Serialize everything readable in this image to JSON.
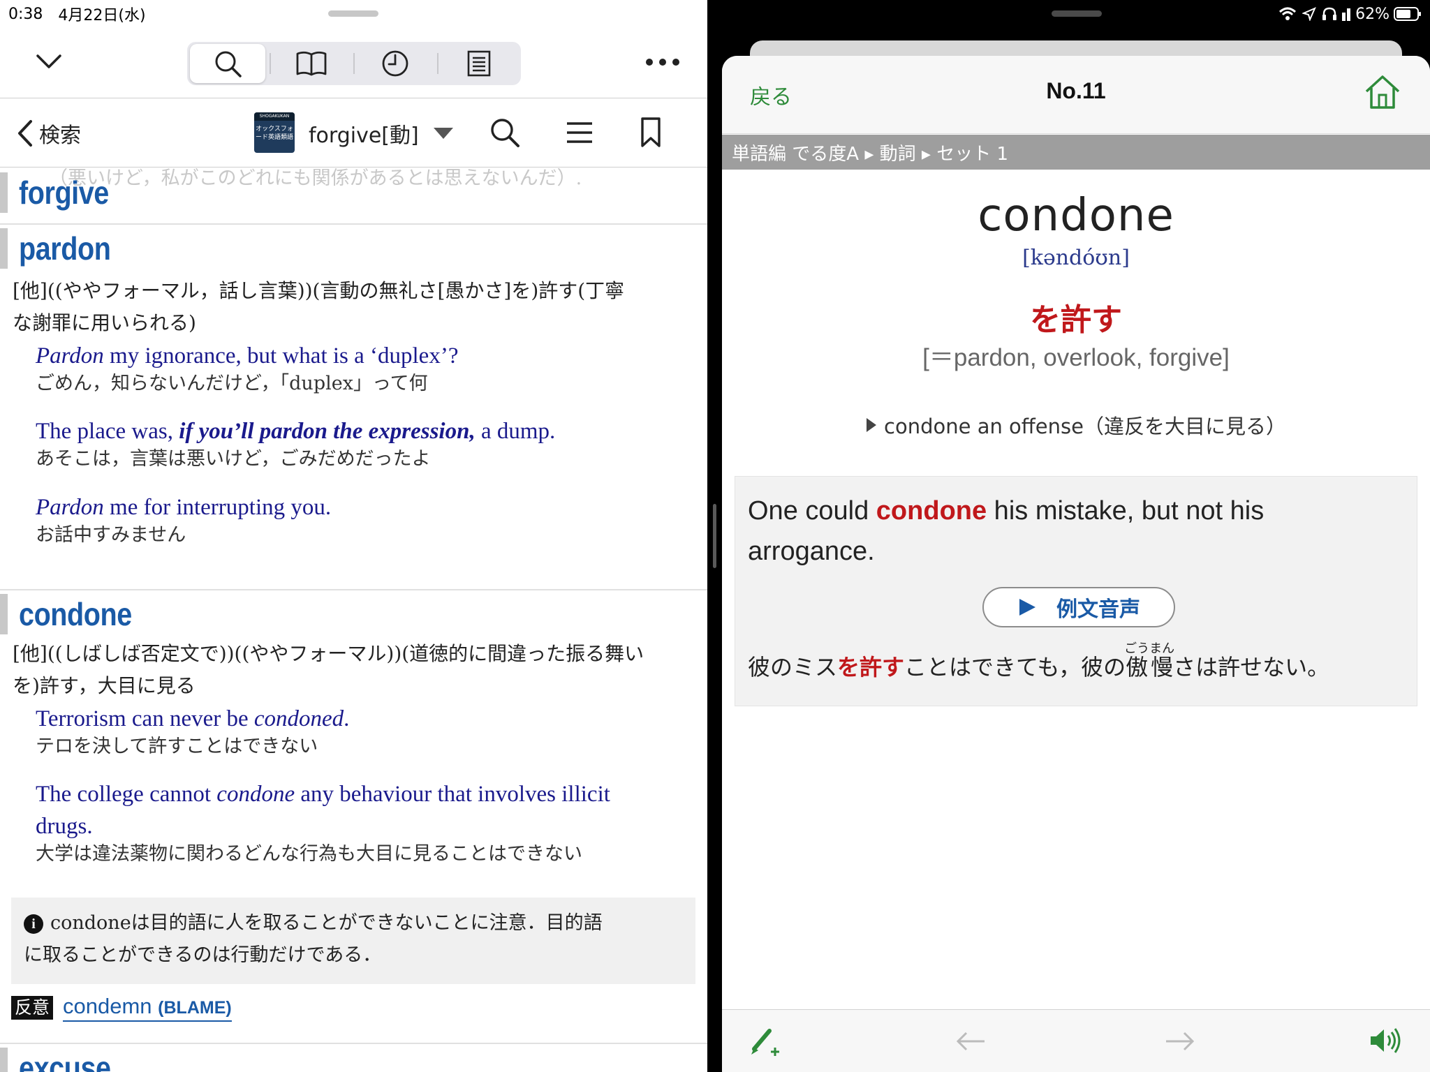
{
  "status_left": {
    "time": "0:38",
    "date": "4月22日(水)"
  },
  "status_right": {
    "battery": "62%"
  },
  "left_toolbar": {
    "tabs": [
      {
        "icon": "search-icon",
        "selected": true
      },
      {
        "icon": "book-icon",
        "selected": false
      },
      {
        "icon": "history-clock-icon",
        "selected": false
      },
      {
        "icon": "list-document-icon",
        "selected": false
      }
    ]
  },
  "left_nav": {
    "back_label": "検索",
    "book_cover_brand": "SHOGAKUKAN",
    "book_cover_title": "オックスフォード英語類語",
    "dropdown_label": "forgive[動]"
  },
  "entries": {
    "cut_off_line": "（悪いけど，私がこのどれにも関係があるとは思えないんだ）.",
    "forgive": {
      "headword": "forgive"
    },
    "pardon": {
      "headword": "pardon",
      "definition_l1": "[他]((ややフォーマル，話し言葉))(言動の無礼さ[愚かさ]を)許す(丁寧",
      "definition_l2": "な謝罪に用いられる)",
      "ex1_a": "Pardon",
      "ex1_b": " my ignorance, but what is a ‘duplex’?",
      "ex1_jp": "ごめん，知らないんだけど，「duplex」って何",
      "ex2_a": "The place was, ",
      "ex2_b": "if you’ll pardon the expression,",
      "ex2_c": " a dump.",
      "ex2_jp": "あそこは，言葉は悪いけど，ごみだめだったよ",
      "ex3_a": "Pardon",
      "ex3_b": " me for interrupting you.",
      "ex3_jp": "お話中すみません"
    },
    "condone": {
      "headword": "condone",
      "definition_l1": "[他]((しばしば否定文で))((ややフォーマル))(道徳的に間違った振る舞い",
      "definition_l2": "を)許す，大目に見る",
      "ex1_a": "Terrorism can never be ",
      "ex1_b": "condoned",
      "ex1_c": ".",
      "ex1_jp": "テロを決して許すことはできない",
      "ex2_a": "The college cannot ",
      "ex2_b": "condone",
      "ex2_c": " any behaviour that involves illicit",
      "ex2_d": "drugs.",
      "ex2_jp": "大学は違法薬物に関わるどんな行為も大目に見ることはできない",
      "note_l1": "condoneは目的語に人を取ることができないことに注意．目的語",
      "note_l2": "に取ることができるのは行動だけである．",
      "antonym_tag": "反意",
      "antonym_word": "condemn",
      "antonym_sense": "(BLAME)"
    },
    "excuse": {
      "headword": "excuse"
    }
  },
  "right_header": {
    "back": "戻る",
    "title": "No.11"
  },
  "breadcrumb": "単語編 でる度A ▸ 動詞 ▸ セット 1",
  "word": {
    "headword": "condone",
    "pronunciation": "[kəndóʊn]",
    "meaning": "を許す",
    "synonyms": "[＝pardon, overlook, forgive]",
    "phrase": "condone an offense（違反を大目に見る）"
  },
  "example": {
    "en_pre": "One could ",
    "en_key": "condone",
    "en_post_l1": " his mistake, but not his",
    "en_l2": "arrogance.",
    "audio_label": "例文音声",
    "jp_pre": "彼のミス",
    "jp_key": "を許す",
    "jp_mid": "ことはできても，彼の",
    "jp_ruby_base": "傲慢",
    "jp_ruby_text": "ごうまん",
    "jp_post": "さは許せない。"
  },
  "colors": {
    "link_blue": "#1a5aa6",
    "accent_red": "#c0181b",
    "app_green": "#2e8b3a",
    "example_blue": "#1a1a8c"
  }
}
